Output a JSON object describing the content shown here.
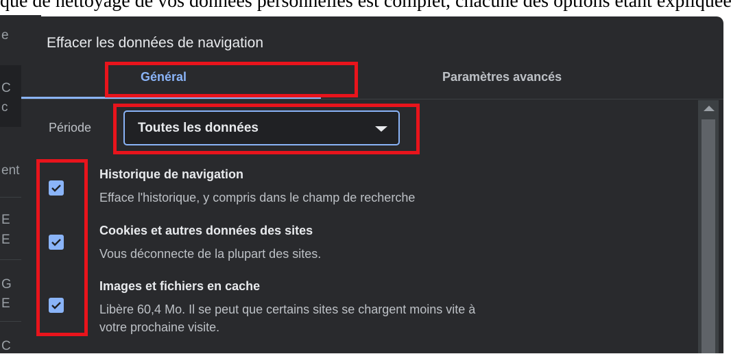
{
  "document_line": "que de nettoyage de vos données personnelles est complet, chacune des options étant expliquée de façon simple et précise",
  "background_fragments": [
    "e",
    "C",
    "c",
    "ent",
    "E",
    "E",
    "G",
    "E",
    "C"
  ],
  "dialog": {
    "title": "Effacer les données de navigation",
    "tabs": [
      {
        "label": "Général",
        "active": true
      },
      {
        "label": "Paramètres avancés",
        "active": false
      }
    ],
    "period": {
      "label": "Période",
      "value": "Toutes les données"
    },
    "items": [
      {
        "title": "Historique de navigation",
        "description": "Efface l'historique, y compris dans le champ de recherche",
        "checked": true
      },
      {
        "title": "Cookies et autres données des sites",
        "description": "Vous déconnecte de la plupart des sites.",
        "checked": true
      },
      {
        "title": "Images et fichiers en cache",
        "description": "Libère 60,4 Mo. Il se peut que certains sites se chargent moins vite à",
        "description_line2": "votre prochaine visite.",
        "checked": true
      }
    ]
  },
  "colors": {
    "dialog_bg": "#292a2d",
    "accent": "#8ab4f8",
    "annotation": "#e8141c"
  }
}
